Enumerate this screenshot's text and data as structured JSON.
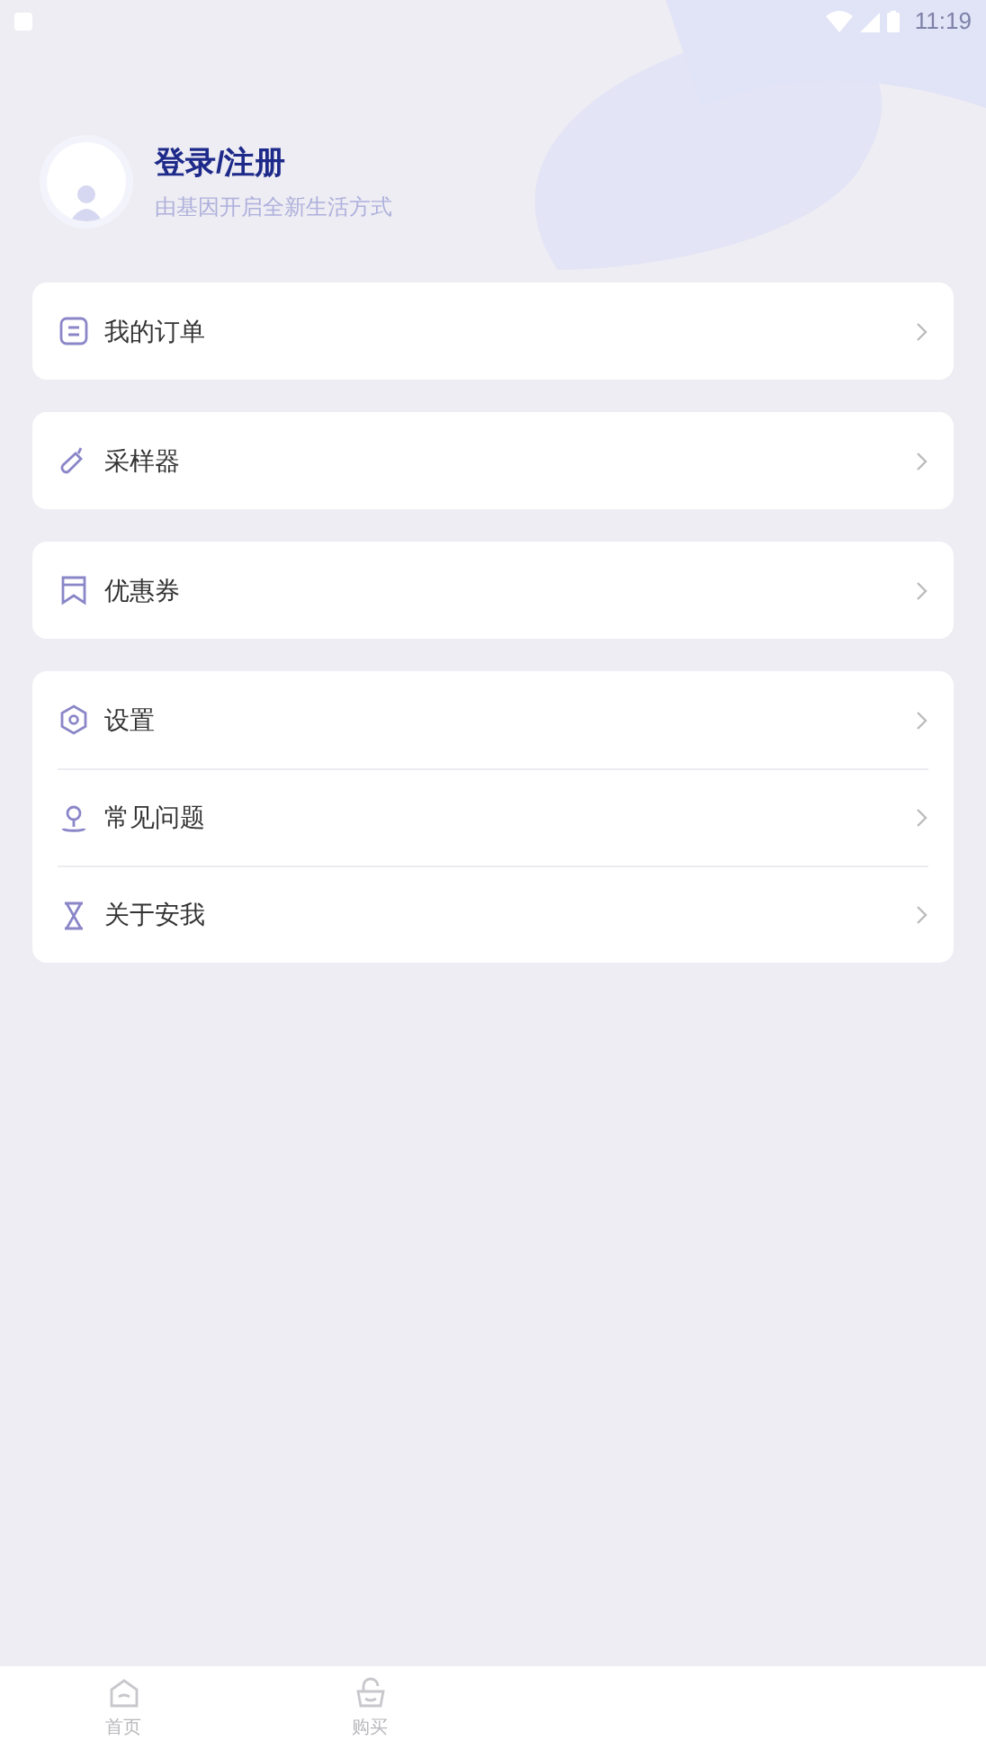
{
  "status_bar": {
    "time": "11:19"
  },
  "profile": {
    "title": "登录/注册",
    "subtitle": "由基因开启全新生活方式"
  },
  "menu_groups": [
    {
      "items": [
        {
          "label": "我的订单",
          "kind": "orders"
        }
      ]
    },
    {
      "items": [
        {
          "label": "采样器",
          "kind": "sampler"
        }
      ]
    },
    {
      "items": [
        {
          "label": "优惠券",
          "kind": "coupon"
        }
      ]
    },
    {
      "items": [
        {
          "label": "设置",
          "kind": "settings"
        },
        {
          "label": "常见问题",
          "kind": "faq"
        },
        {
          "label": "关于安我",
          "kind": "about"
        }
      ]
    }
  ],
  "tab_bar": [
    {
      "label": "首页",
      "kind": "home",
      "selected": false
    },
    {
      "label": "购买",
      "kind": "basket",
      "selected": false
    }
  ]
}
